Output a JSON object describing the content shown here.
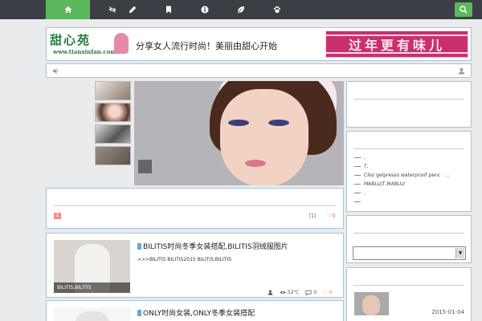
{
  "nav": {
    "items": [
      {
        "icon": "home-icon",
        "active": true
      },
      {
        "icon": "eye-slash-icon",
        "active": false
      },
      {
        "icon": "pencil-icon",
        "active": false
      },
      {
        "icon": "bookmark-icon",
        "active": false
      },
      {
        "icon": "info-icon",
        "active": false
      },
      {
        "icon": "leaf-icon",
        "active": false
      },
      {
        "icon": "paw-icon",
        "active": false
      }
    ],
    "search_icon": "search-icon",
    "accent": "#5cb85c"
  },
  "header": {
    "logo_cn": "甜心苑",
    "logo_url": "www.tianxinfan.com",
    "slogan": "分享女人流行时尚！美丽由甜心开始",
    "ad_text": "过年更有味儿"
  },
  "notice": {
    "left_icon": "speaker-icon",
    "right_icon": "user-icon"
  },
  "box1": {
    "number": "1",
    "count": "(1)",
    "likes": "0"
  },
  "posts": [
    {
      "title": "BILITIS时尚冬季女装搭配,BILITIS羽绒服图片",
      "excerpt": ">>>BILITIS BILITIS2015 BILITIS,BILITIS",
      "img_caption": "BILITIS,BILITIS",
      "views": "52℃",
      "comments": "0",
      "likes": "0"
    },
    {
      "title": "ONLY时尚女装,ONLY冬季女装搭配"
    }
  ],
  "sidebar": {
    "list": [
      ",",
      "T,",
      "Clio/ gelpresso waterproof penc",
      "MABLU/T,MABLU/",
      ",",
      ""
    ],
    "list_more": "...",
    "select_arrow": "▼",
    "recent_date": "2015-01-04"
  }
}
